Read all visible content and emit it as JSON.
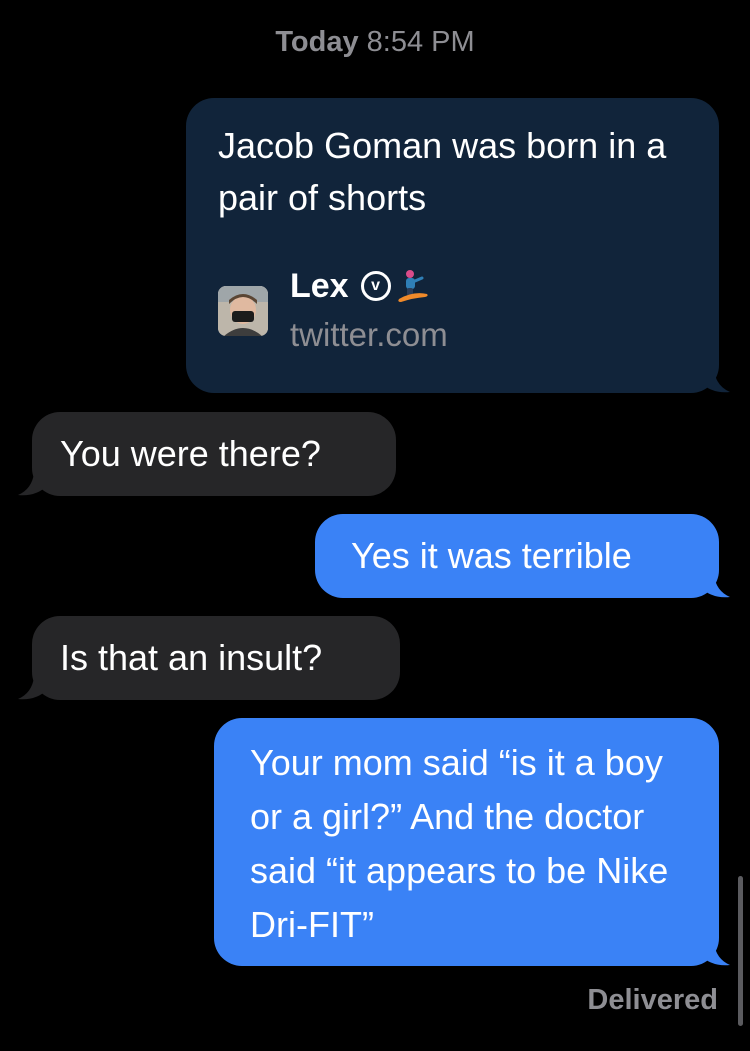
{
  "header": {
    "day": "Today",
    "time": "8:54 PM"
  },
  "messages": [
    {
      "direction": "sent",
      "type": "link",
      "text": "Jacob Goman was born in a pair of shorts",
      "preview": {
        "title": "Lex",
        "title_suffix": "🏂",
        "domain": "twitter.com",
        "verified_glyph": "v"
      }
    },
    {
      "direction": "received",
      "text": "You were there?"
    },
    {
      "direction": "sent",
      "text": "Yes it was terrible"
    },
    {
      "direction": "received",
      "text": "Is that an insult?"
    },
    {
      "direction": "sent",
      "text": "Your mom said “is it a boy or a girl?” And the doctor said “it appears to be Nike Dri-FIT”"
    }
  ],
  "status": {
    "delivered": "Delivered"
  },
  "colors": {
    "sent_bubble": "#3a82f6",
    "received_bubble": "#262628",
    "link_bubble": "#11243a",
    "meta_text": "#8e8e93"
  }
}
